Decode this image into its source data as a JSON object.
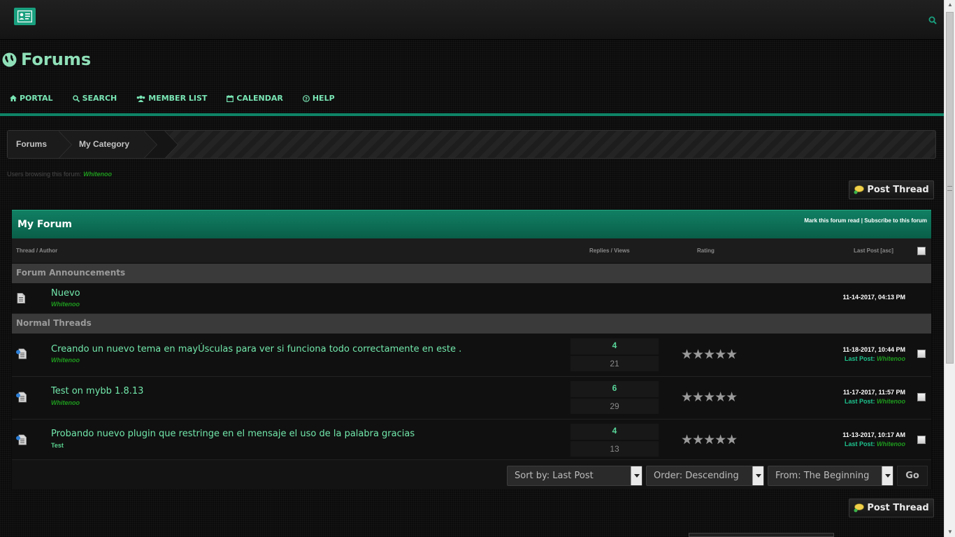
{
  "header": {
    "logo_icon": "contact-card-icon",
    "search_icon": "search-icon"
  },
  "page_title": "Forums",
  "nav": [
    {
      "label": "PORTAL",
      "icon": "home-icon"
    },
    {
      "label": "SEARCH",
      "icon": "search-icon"
    },
    {
      "label": "MEMBER LIST",
      "icon": "users-icon"
    },
    {
      "label": "CALENDAR",
      "icon": "calendar-icon"
    },
    {
      "label": "HELP",
      "icon": "help-icon"
    }
  ],
  "breadcrumb": [
    "Forums",
    "My Category",
    "My Forum"
  ],
  "browsing": {
    "label": "Users browsing this forum:",
    "user": "Whitenoo"
  },
  "post_thread_label": "Post Thread",
  "forum": {
    "title": "My Forum",
    "mark_read": "Mark this forum read",
    "subscribe": "Subscribe to this forum",
    "separator": "|"
  },
  "columns": {
    "thread_author": "Thread / Author",
    "replies_views": "Replies / Views",
    "rating": "Rating",
    "last_post": "Last Post [asc]"
  },
  "sections": {
    "announcements": "Forum Announcements",
    "normal": "Normal Threads"
  },
  "announcement": {
    "subject": "Nuevo",
    "author": "Whitenoo",
    "date": "11-14-2017, 04:13 PM"
  },
  "threads": [
    {
      "subject": "Creando un nuevo tema en mayÚsculas para ver si funciona todo correctamente en este .",
      "author": "Whitenoo",
      "replies": "4",
      "views": "21",
      "rating": "★★★★★",
      "date": "11-18-2017, 10:44 PM",
      "last_post_label": "Last Post:",
      "last_post_user": "Whitenoo"
    },
    {
      "subject": "Test on mybb 1.8.13",
      "author": "Whitenoo",
      "replies": "6",
      "views": "29",
      "rating": "★★★★★",
      "date": "11-17-2017, 11:57 PM",
      "last_post_label": "Last Post:",
      "last_post_user": "Whitenoo"
    },
    {
      "subject": "Probando nuevo plugin que restringe en el mensaje el uso de la palabra gracias",
      "author": "Test",
      "replies": "4",
      "views": "13",
      "rating": "★★★★★",
      "date": "11-13-2017, 10:17 AM",
      "last_post_label": "Last Post:",
      "last_post_user": "Whitenoo"
    }
  ],
  "sort": {
    "sort_by": "Sort by: Last Post",
    "order": "Order: Descending",
    "from": "From: The Beginning",
    "go": "Go"
  },
  "colors": {
    "accent": "#0e8466",
    "link": "#72e9ac",
    "user": "#1e9b1e"
  }
}
